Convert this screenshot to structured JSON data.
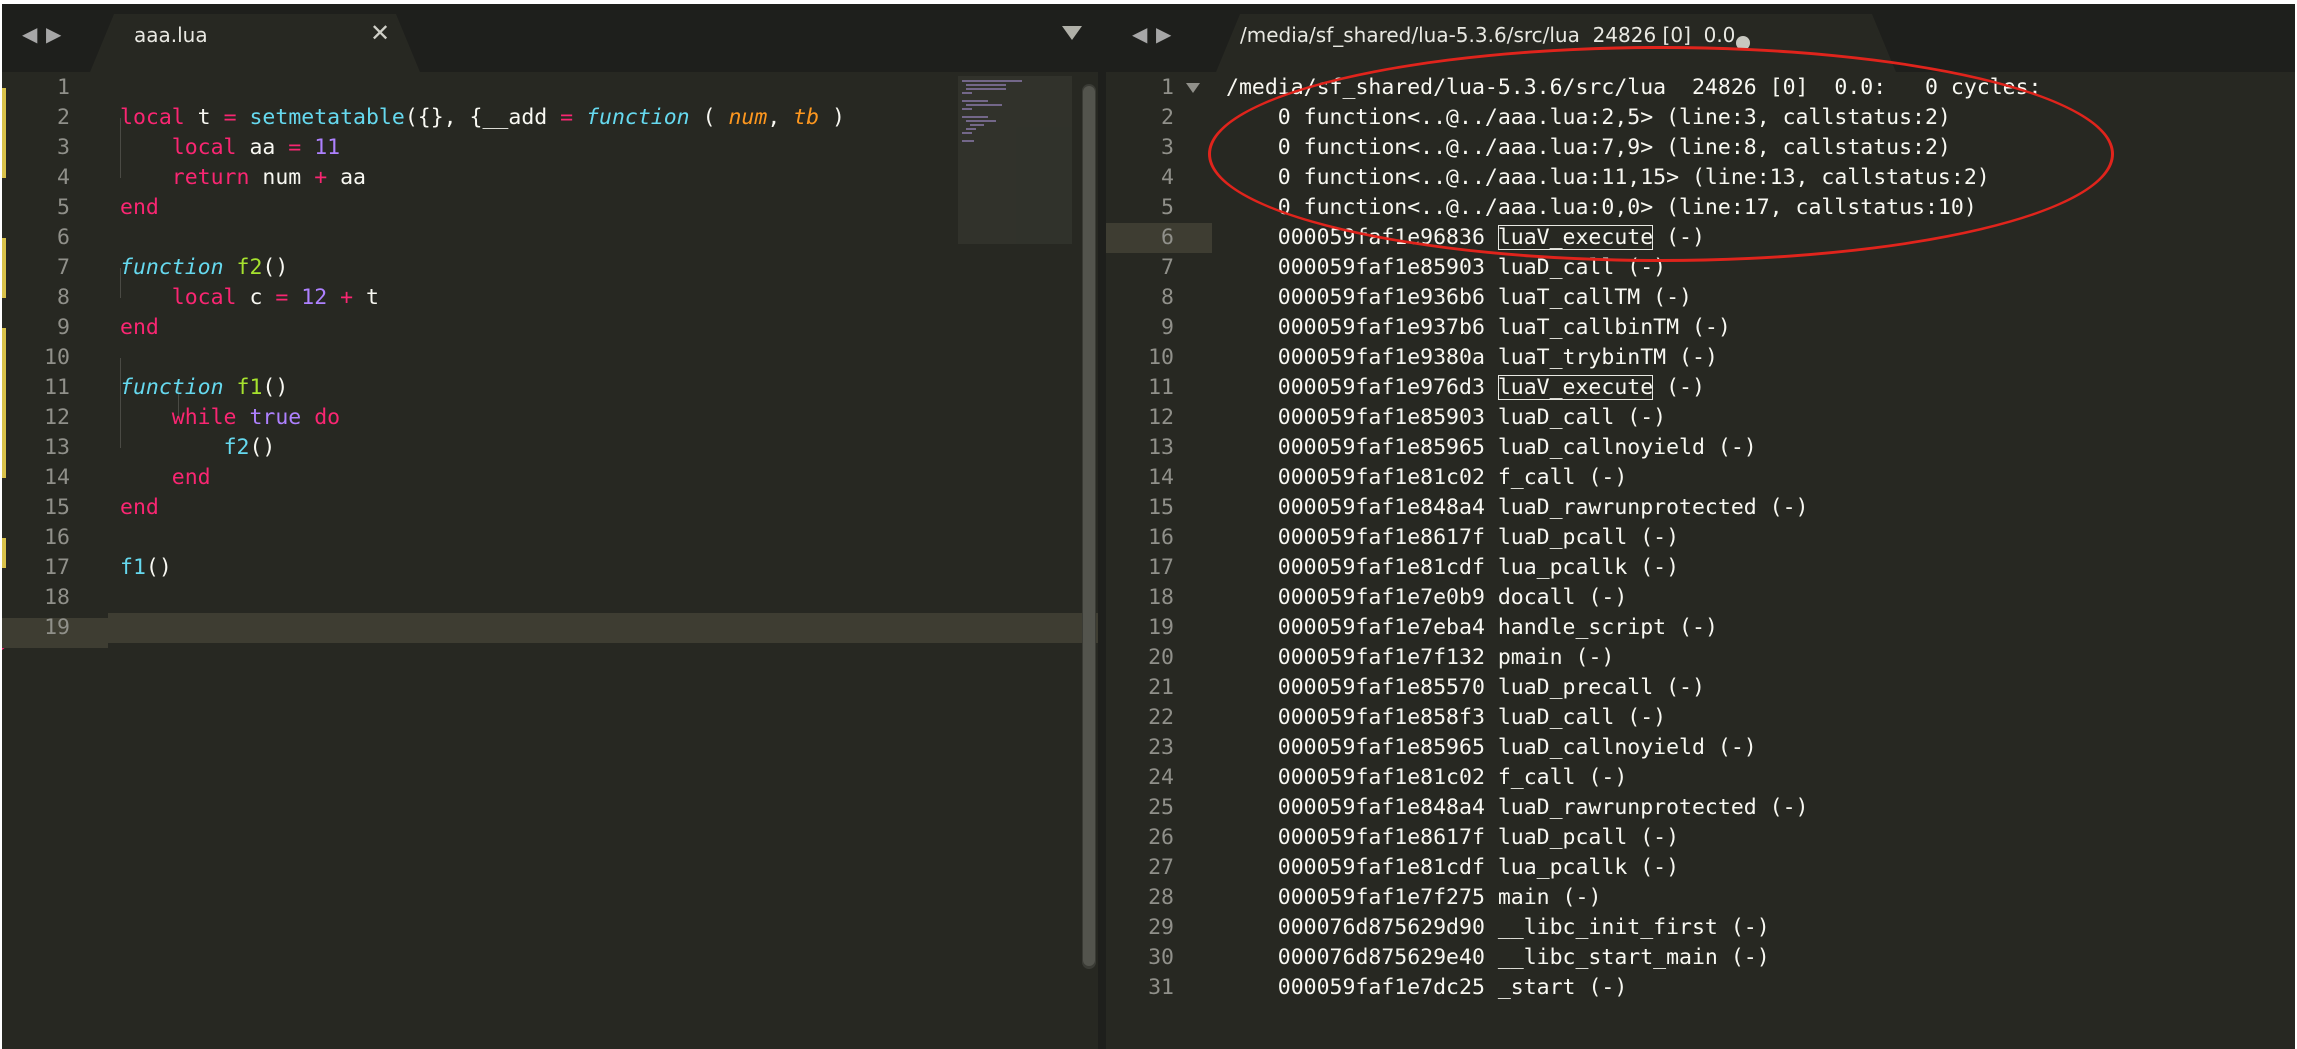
{
  "left_pane": {
    "tab_title": "aaa.lua",
    "close_glyph": "✕",
    "line_numbers": [
      "1",
      "2",
      "3",
      "4",
      "5",
      "6",
      "7",
      "8",
      "9",
      "10",
      "11",
      "12",
      "13",
      "14",
      "15",
      "16",
      "17",
      "18",
      "19"
    ]
  },
  "right_pane": {
    "tab_title": "/media/sf_shared/lua-5.3.6/src/lua  24826 [0]  0.0",
    "line_numbers": [
      "1",
      "2",
      "3",
      "4",
      "5",
      "6",
      "7",
      "8",
      "9",
      "10",
      "11",
      "12",
      "13",
      "14",
      "15",
      "16",
      "17",
      "18",
      "19",
      "20",
      "21",
      "22",
      "23",
      "24",
      "25",
      "26",
      "27",
      "28",
      "29",
      "30",
      "31"
    ],
    "header_line": "/media/sf_shared/lua-5.3.6/src/lua  24826 [0]  0.0:   0 cycles:",
    "frames": [
      "    0 function<..@../aaa.lua:2,5> (line:3, callstatus:2)",
      "    0 function<..@../aaa.lua:7,9> (line:8, callstatus:2)",
      "    0 function<..@../aaa.lua:11,15> (line:13, callstatus:2)",
      "    0 function<..@../aaa.lua:0,0> (line:17, callstatus:10)"
    ],
    "stack": [
      {
        "addr": "    000059faf1e96836 ",
        "sym": "luaV_execute",
        "rest": " (-)",
        "boxed": true
      },
      {
        "addr": "    000059faf1e85903 ",
        "sym": "luaD_call",
        "rest": " (-)"
      },
      {
        "addr": "    000059faf1e936b6 ",
        "sym": "luaT_callTM",
        "rest": " (-)"
      },
      {
        "addr": "    000059faf1e937b6 ",
        "sym": "luaT_callbinTM",
        "rest": " (-)"
      },
      {
        "addr": "    000059faf1e9380a ",
        "sym": "luaT_trybinTM",
        "rest": " (-)"
      },
      {
        "addr": "    000059faf1e976d3 ",
        "sym": "luaV_execute",
        "rest": " (-)",
        "boxed": true
      },
      {
        "addr": "    000059faf1e85903 ",
        "sym": "luaD_call",
        "rest": " (-)"
      },
      {
        "addr": "    000059faf1e85965 ",
        "sym": "luaD_callnoyield",
        "rest": " (-)"
      },
      {
        "addr": "    000059faf1e81c02 ",
        "sym": "f_call",
        "rest": " (-)"
      },
      {
        "addr": "    000059faf1e848a4 ",
        "sym": "luaD_rawrunprotected",
        "rest": " (-)"
      },
      {
        "addr": "    000059faf1e8617f ",
        "sym": "luaD_pcall",
        "rest": " (-)"
      },
      {
        "addr": "    000059faf1e81cdf ",
        "sym": "lua_pcallk",
        "rest": " (-)"
      },
      {
        "addr": "    000059faf1e7e0b9 ",
        "sym": "docall",
        "rest": " (-)"
      },
      {
        "addr": "    000059faf1e7eba4 ",
        "sym": "handle_script",
        "rest": " (-)"
      },
      {
        "addr": "    000059faf1e7f132 ",
        "sym": "pmain",
        "rest": " (-)"
      },
      {
        "addr": "    000059faf1e85570 ",
        "sym": "luaD_precall",
        "rest": " (-)"
      },
      {
        "addr": "    000059faf1e858f3 ",
        "sym": "luaD_call",
        "rest": " (-)"
      },
      {
        "addr": "    000059faf1e85965 ",
        "sym": "luaD_callnoyield",
        "rest": " (-)"
      },
      {
        "addr": "    000059faf1e81c02 ",
        "sym": "f_call",
        "rest": " (-)"
      },
      {
        "addr": "    000059faf1e848a4 ",
        "sym": "luaD_rawrunprotected",
        "rest": " (-)"
      },
      {
        "addr": "    000059faf1e8617f ",
        "sym": "luaD_pcall",
        "rest": " (-)"
      },
      {
        "addr": "    000059faf1e81cdf ",
        "sym": "lua_pcallk",
        "rest": " (-)"
      },
      {
        "addr": "    000059faf1e7f275 ",
        "sym": "main",
        "rest": " (-)"
      },
      {
        "addr": "    000076d875629d90 ",
        "sym": "__libc_init_first",
        "rest": " (-)"
      },
      {
        "addr": "    000076d875629e40 ",
        "sym": "__libc_start_main",
        "rest": " (-)"
      },
      {
        "addr": "    000059faf1e7dc25 ",
        "sym": "_start",
        "rest": " (-)"
      }
    ]
  },
  "code": {
    "l2": [
      "local",
      " t ",
      "=",
      " ",
      "setmetatable",
      "({}, {__add ",
      "=",
      " ",
      "function",
      " ( ",
      "num",
      ", ",
      "tb",
      " )"
    ],
    "l3": [
      "    ",
      "local",
      " aa ",
      "=",
      " ",
      "11"
    ],
    "l4": [
      "    ",
      "return",
      " num ",
      "+",
      " aa"
    ],
    "l5": [
      "end"
    ],
    "l7": [
      "function",
      " ",
      "f2",
      "()"
    ],
    "l8": [
      "    ",
      "local",
      " c ",
      "=",
      " ",
      "12",
      " ",
      "+",
      " t"
    ],
    "l9": [
      "end"
    ],
    "l11": [
      "function",
      " ",
      "f1",
      "()"
    ],
    "l12": [
      "    ",
      "while",
      " ",
      "true",
      " ",
      "do"
    ],
    "l13": [
      "        ",
      "f2",
      "()"
    ],
    "l14": [
      "    ",
      "end"
    ],
    "l15": [
      "end"
    ],
    "l17": [
      "f1",
      "()"
    ]
  },
  "colors": {
    "background": "#272822",
    "keyword": "#f92672",
    "builtin": "#66d9ef",
    "param": "#fd971f",
    "number": "#ae81ff",
    "func_name": "#a6e22e",
    "annotation_oval": "#e0241c"
  },
  "icons": [
    "nav-left-icon",
    "nav-right-icon",
    "close-icon",
    "dropdown-icon",
    "dirty-indicator-icon",
    "fold-arrow-icon"
  ]
}
